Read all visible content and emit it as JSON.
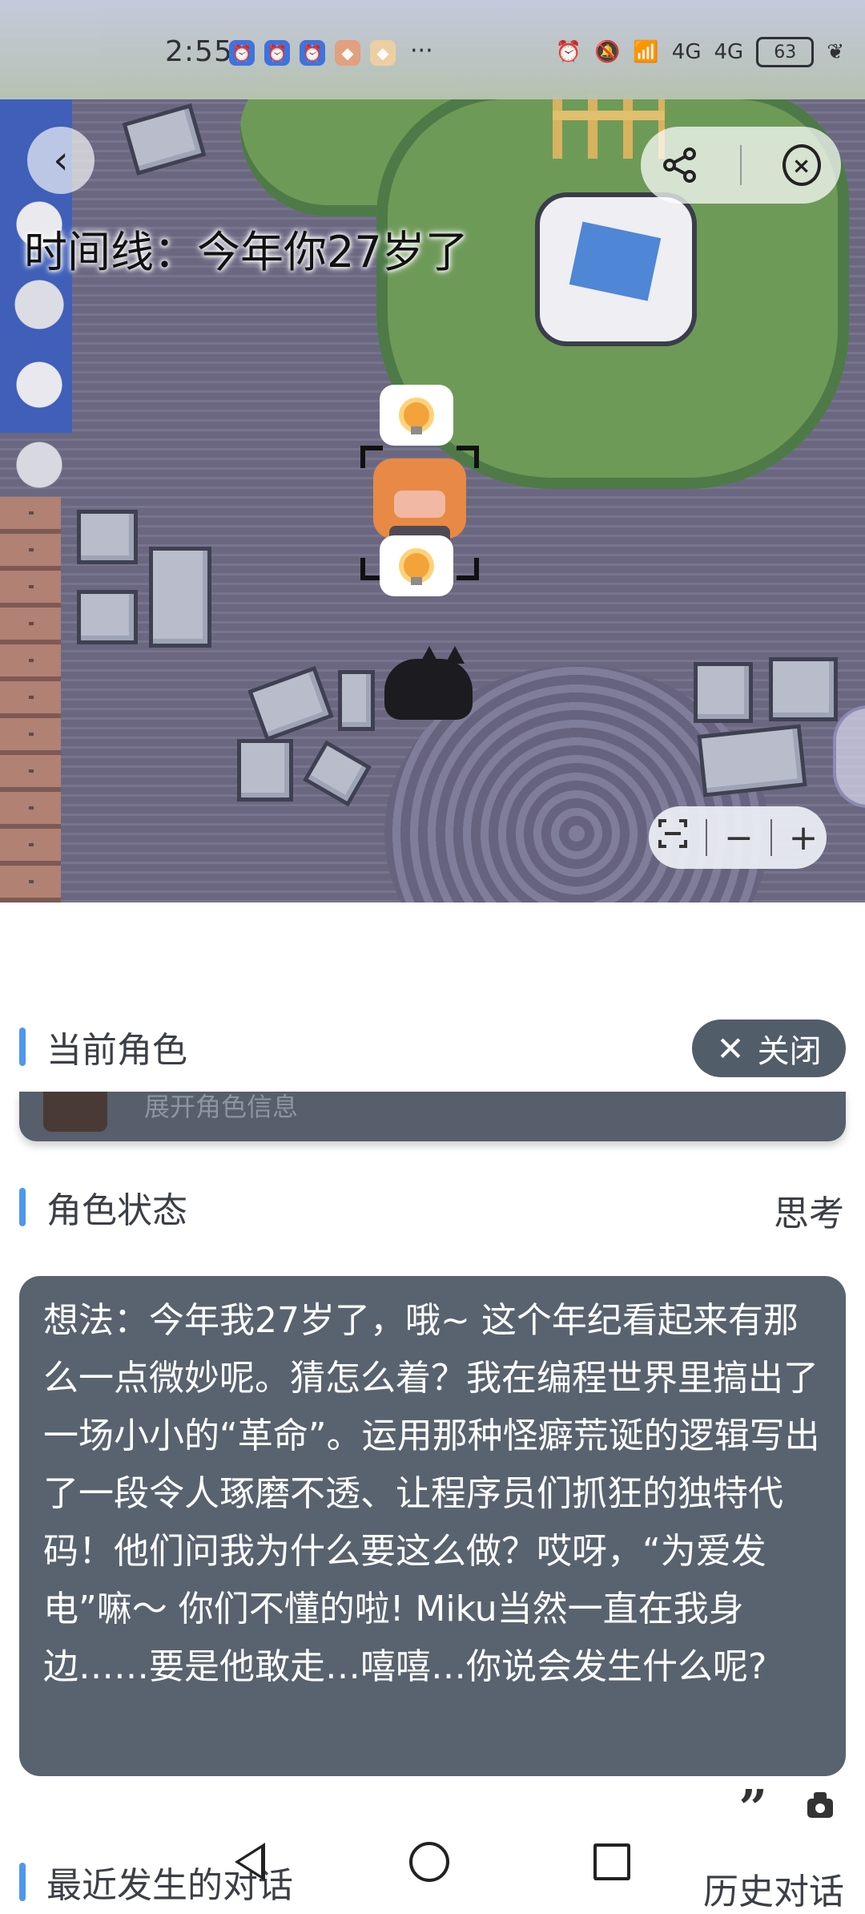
{
  "status_bar": {
    "time": "2:55",
    "notification_icons": [
      "alarm-app-icon",
      "alarm-app-icon",
      "alarm-app-icon",
      "game-app-icon",
      "game-app-icon"
    ],
    "more": "···",
    "signal_1": "4G",
    "signal_2": "4G",
    "battery": "63"
  },
  "map": {
    "timeline_text": "时间线：今年你27岁了",
    "zoom_minus": "−",
    "zoom_plus": "+"
  },
  "panel": {
    "current_role_title": "当前角色",
    "close_label": "关闭",
    "expand_role_info": "展开角色信息",
    "role_status_title": "角色状态",
    "thinking_label": "思考",
    "thought_text": "想法：今年我27岁了，哦~ 这个年纪看起来有那么一点微妙呢。猜怎么着？我在编程世界里搞出了一场小小的“革命”。运用那种怪癖荒诞的逻辑写出了一段令人琢磨不透、让程序员们抓狂的独特代码！他们问我为什么要这么做？哎呀，“为爱发电”嘛～ 你们不懂的啦! Miku当然一直在我身边……要是他敢走…嘻嘻…你说会发生什么呢?",
    "recent_dialog_title": "最近发生的对话",
    "history_dialog_label": "历史对话"
  },
  "colors": {
    "accent": "#4f97ee",
    "card_bg": "#59636f",
    "chip_bg": "#525d6a"
  }
}
